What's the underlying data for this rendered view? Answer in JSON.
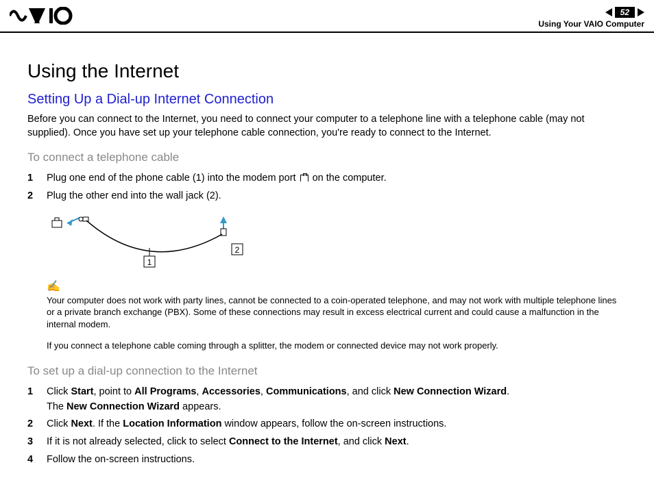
{
  "header": {
    "logo": "VAIO",
    "page_number": "52",
    "breadcrumb": "Using Your VAIO Computer"
  },
  "title": "Using the Internet",
  "subtitle": "Setting Up a Dial-up Internet Connection",
  "intro": "Before you can connect to the Internet, you need to connect your computer to a telephone line with a telephone cable (may not supplied). Once you have set up your telephone cable connection, you're ready to connect to the Internet.",
  "section1_heading": "To connect a telephone cable",
  "section1_steps": [
    {
      "num": "1",
      "text_before": "Plug one end of the phone cable (1) into the modem port ",
      "text_after": " on the computer."
    },
    {
      "num": "2",
      "text_before": "Plug the other end into the wall jack (2).",
      "text_after": ""
    }
  ],
  "diagram": {
    "label1": "1",
    "label2": "2"
  },
  "note1": "Your computer does not work with party lines, cannot be connected to a coin-operated telephone, and may not work with multiple telephone lines or a private branch exchange (PBX). Some of these connections may result in excess electrical current and could cause a malfunction in the internal modem.",
  "note2": "If you connect a telephone cable coming through a splitter, the modem or connected device may not work properly.",
  "section2_heading": "To set up a dial-up connection to the Internet",
  "section2_steps": [
    {
      "num": "1",
      "parts": [
        {
          "t": "Click "
        },
        {
          "b": "Start"
        },
        {
          "t": ", point to "
        },
        {
          "b": "All Programs"
        },
        {
          "t": ", "
        },
        {
          "b": "Accessories"
        },
        {
          "t": ", "
        },
        {
          "b": "Communications"
        },
        {
          "t": ", and click "
        },
        {
          "b": "New Connection Wizard"
        },
        {
          "t": "."
        },
        {
          "br": true
        },
        {
          "t": "The "
        },
        {
          "b": "New Connection Wizard"
        },
        {
          "t": " appears."
        }
      ]
    },
    {
      "num": "2",
      "parts": [
        {
          "t": "Click "
        },
        {
          "b": "Next"
        },
        {
          "t": ". If the "
        },
        {
          "b": "Location Information"
        },
        {
          "t": " window appears, follow the on-screen instructions."
        }
      ]
    },
    {
      "num": "3",
      "parts": [
        {
          "t": "If it is not already selected, click to select "
        },
        {
          "b": "Connect to the Internet"
        },
        {
          "t": ", and click "
        },
        {
          "b": "Next"
        },
        {
          "t": "."
        }
      ]
    },
    {
      "num": "4",
      "parts": [
        {
          "t": "Follow the on-screen instructions."
        }
      ]
    }
  ]
}
